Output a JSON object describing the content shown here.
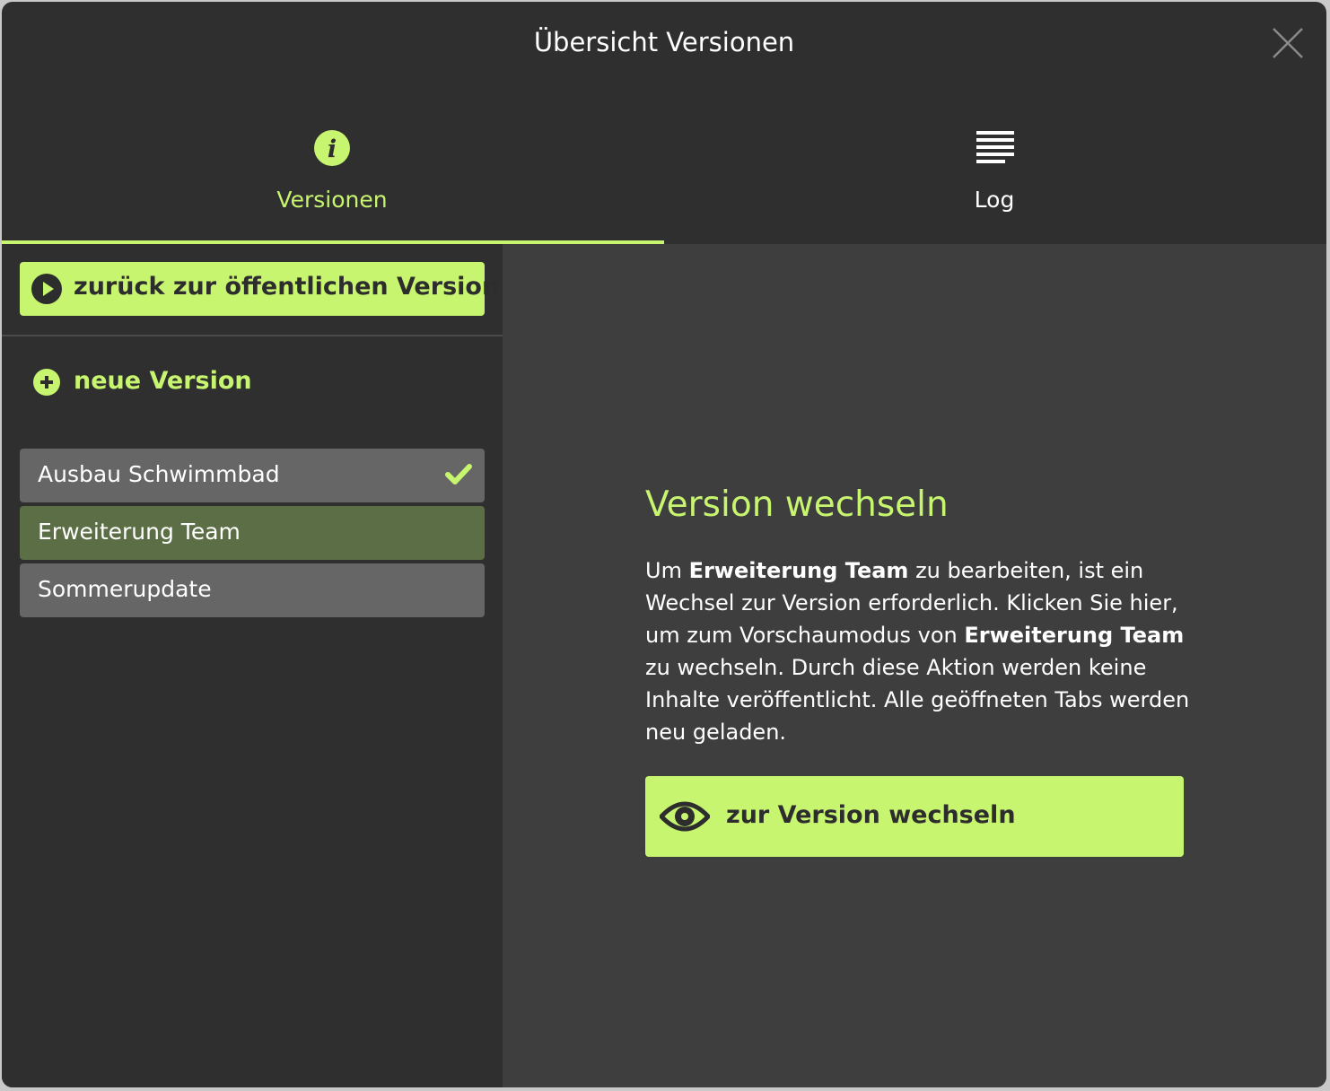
{
  "dialog": {
    "title": "Übersicht Versionen"
  },
  "tabs": [
    {
      "label": "Versionen",
      "icon": "info-icon",
      "active": true
    },
    {
      "label": "Log",
      "icon": "lines-icon",
      "active": false
    }
  ],
  "sidebar": {
    "back_label": "zurück zur öffentlichen Version",
    "new_version_label": "neue Version",
    "versions": [
      {
        "label": "Ausbau Schwimmbad",
        "status": "checked"
      },
      {
        "label": "Erweiterung Team",
        "status": "selected"
      },
      {
        "label": "Sommerupdate",
        "status": ""
      }
    ]
  },
  "main": {
    "heading": "Version wechseln",
    "text": {
      "p1": "Um ",
      "b1": "Erweiterung Team",
      "p2": " zu bearbeiten, ist ein Wechsel zur Version erforderlich. Klicken Sie hier, um zum Vorschaumodus von ",
      "b2": "Erweiterung Team",
      "p3": " zu wechseln. Durch diese Aktion werden keine Inhalte veröffentlicht. Alle geöffneten Tabs werden neu geladen."
    },
    "switch_label": "zur Version wechseln"
  },
  "colors": {
    "accent": "#c8f56f",
    "modal_bg": "#2f2f2f",
    "panel_bg": "#3e3e3e",
    "item_bg": "#666666",
    "item_selected_bg": "#5c6e45"
  }
}
